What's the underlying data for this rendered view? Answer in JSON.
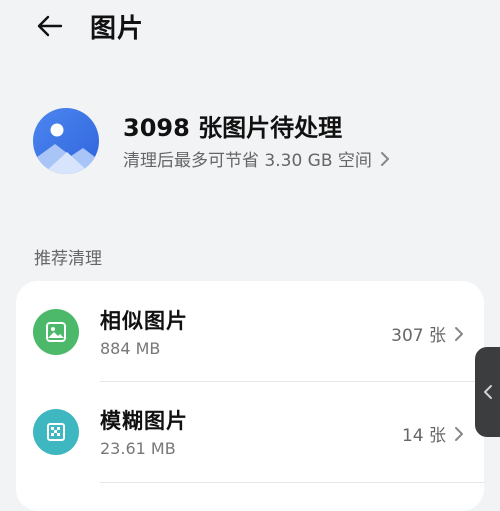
{
  "header": {
    "title": "图片"
  },
  "summary": {
    "title": "3098 张图片待处理",
    "subtitle": "清理后最多可节省 3.30 GB 空间"
  },
  "section": {
    "label": "推荐清理"
  },
  "items": [
    {
      "title": "相似图片",
      "size": "884 MB",
      "count": "307 张",
      "icon": "image-icon",
      "color": "#4cb86a"
    },
    {
      "title": "模糊图片",
      "size": "23.61 MB",
      "count": "14 张",
      "icon": "blur-grid-icon",
      "color": "#3fb7c0"
    }
  ],
  "colors": {
    "background": "#f1f3f5",
    "card": "#ffffff",
    "summary_icon_blue": "#3a73e8",
    "handle": "#3b3d3f"
  }
}
